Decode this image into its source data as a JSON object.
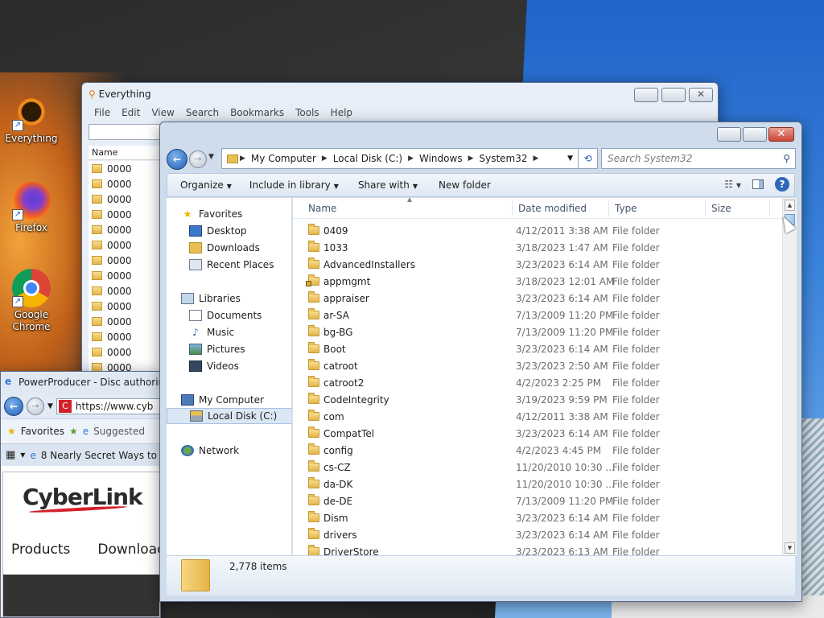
{
  "desktop": {
    "icons": [
      {
        "label": "Everything",
        "icon": "everything-icon",
        "color": "#f08a1c"
      },
      {
        "label": "Firefox",
        "icon": "firefox-icon",
        "color": "#e66000"
      },
      {
        "label": "Google Chrome",
        "icon": "chrome-icon",
        "color": "#4285f4"
      }
    ]
  },
  "everything": {
    "title": "Everything",
    "menu": [
      "File",
      "Edit",
      "View",
      "Search",
      "Bookmarks",
      "Tools",
      "Help"
    ],
    "column_name": "Name",
    "rows": [
      "0000",
      "0000",
      "0000",
      "0000",
      "0000",
      "0000",
      "0000",
      "0000",
      "0000",
      "0000",
      "0000",
      "0000",
      "0000",
      "0000"
    ]
  },
  "ie": {
    "title": "PowerProducer - Disc authoring f",
    "url": "https://www.cyb",
    "favorites_label": "Favorites",
    "suggested_label": "Suggested",
    "tab_label": "8 Nearly Secret Ways to",
    "logo": "CyberLink",
    "nav": [
      "Products",
      "Downloads"
    ]
  },
  "explorer": {
    "breadcrumb": [
      "My Computer",
      "Local Disk (C:)",
      "Windows",
      "System32"
    ],
    "search_placeholder": "Search System32",
    "toolbar": {
      "organize": "Organize",
      "include_in_library": "Include in library",
      "share_with": "Share with",
      "new_folder": "New folder"
    },
    "nav": {
      "favorites": "Favorites",
      "desktop": "Desktop",
      "downloads": "Downloads",
      "recent_places": "Recent Places",
      "libraries": "Libraries",
      "documents": "Documents",
      "music": "Music",
      "pictures": "Pictures",
      "videos": "Videos",
      "my_computer": "My Computer",
      "local_disk": "Local Disk (C:)",
      "network": "Network"
    },
    "columns": {
      "name": "Name",
      "date": "Date modified",
      "type": "Type",
      "size": "Size"
    },
    "files": [
      {
        "name": "0409",
        "date": "4/12/2011 3:38 AM",
        "type": "File folder"
      },
      {
        "name": "1033",
        "date": "3/18/2023 1:47 AM",
        "type": "File folder"
      },
      {
        "name": "AdvancedInstallers",
        "date": "3/23/2023 6:14 AM",
        "type": "File folder"
      },
      {
        "name": "appmgmt",
        "date": "3/18/2023 12:01 AM",
        "type": "File folder",
        "locked": true
      },
      {
        "name": "appraiser",
        "date": "3/23/2023 6:14 AM",
        "type": "File folder"
      },
      {
        "name": "ar-SA",
        "date": "7/13/2009 11:20 PM",
        "type": "File folder"
      },
      {
        "name": "bg-BG",
        "date": "7/13/2009 11:20 PM",
        "type": "File folder"
      },
      {
        "name": "Boot",
        "date": "3/23/2023 6:14 AM",
        "type": "File folder"
      },
      {
        "name": "catroot",
        "date": "3/23/2023 2:50 AM",
        "type": "File folder"
      },
      {
        "name": "catroot2",
        "date": "4/2/2023 2:25 PM",
        "type": "File folder"
      },
      {
        "name": "CodeIntegrity",
        "date": "3/19/2023 9:59 PM",
        "type": "File folder"
      },
      {
        "name": "com",
        "date": "4/12/2011 3:38 AM",
        "type": "File folder"
      },
      {
        "name": "CompatTel",
        "date": "3/23/2023 6:14 AM",
        "type": "File folder"
      },
      {
        "name": "config",
        "date": "4/2/2023 4:45 PM",
        "type": "File folder"
      },
      {
        "name": "cs-CZ",
        "date": "11/20/2010 10:30 ...",
        "type": "File folder"
      },
      {
        "name": "da-DK",
        "date": "11/20/2010 10:30 ...",
        "type": "File folder"
      },
      {
        "name": "de-DE",
        "date": "7/13/2009 11:20 PM",
        "type": "File folder"
      },
      {
        "name": "Dism",
        "date": "3/23/2023 6:14 AM",
        "type": "File folder"
      },
      {
        "name": "drivers",
        "date": "3/23/2023 6:14 AM",
        "type": "File folder"
      },
      {
        "name": "DriverStore",
        "date": "3/23/2023 6:13 AM",
        "type": "File folder"
      }
    ],
    "status": "2,778 items"
  }
}
